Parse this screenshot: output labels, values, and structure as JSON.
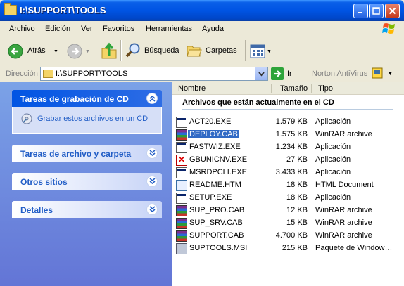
{
  "window": {
    "title": "I:\\SUPPORT\\TOOLS"
  },
  "menu": {
    "items": [
      "Archivo",
      "Edición",
      "Ver",
      "Favoritos",
      "Herramientas",
      "Ayuda"
    ]
  },
  "toolbar": {
    "back_label": "Atrás",
    "search_label": "Búsqueda",
    "folders_label": "Carpetas"
  },
  "address": {
    "label": "Dirección",
    "value": "I:\\SUPPORT\\TOOLS",
    "go_label": "Ir",
    "antivirus_label": "Norton AntiVirus"
  },
  "tasks": {
    "cd_title": "Tareas de grabación de CD",
    "cd_link": "Grabar estos archivos en un CD",
    "file_title": "Tareas de archivo y carpeta",
    "other_title": "Otros sitios",
    "details_title": "Detalles"
  },
  "columns": {
    "name": "Nombre",
    "size": "Tamaño",
    "type": "Tipo"
  },
  "group_title": "Archivos que están actualmente en el CD",
  "files": [
    {
      "name": "ACT20.EXE",
      "size": "1.579 KB",
      "type": "Aplicación",
      "icon": "exe-icon"
    },
    {
      "name": "DEPLOY.CAB",
      "size": "1.575 KB",
      "type": "WinRAR archive",
      "icon": "cab-icon",
      "selected": true
    },
    {
      "name": "FASTWIZ.EXE",
      "size": "1.234 KB",
      "type": "Aplicación",
      "icon": "exe-icon"
    },
    {
      "name": "GBUNICNV.EXE",
      "size": "27 KB",
      "type": "Aplicación",
      "icon": "gbunicnv-icon"
    },
    {
      "name": "MSRDPCLI.EXE",
      "size": "3.433 KB",
      "type": "Aplicación",
      "icon": "exe-icon"
    },
    {
      "name": "README.HTM",
      "size": "18 KB",
      "type": "HTML Document",
      "icon": "htm-icon"
    },
    {
      "name": "SETUP.EXE",
      "size": "18 KB",
      "type": "Aplicación",
      "icon": "exe-icon"
    },
    {
      "name": "SUP_PRO.CAB",
      "size": "12 KB",
      "type": "WinRAR archive",
      "icon": "cab-icon"
    },
    {
      "name": "SUP_SRV.CAB",
      "size": "15 KB",
      "type": "WinRAR archive",
      "icon": "cab-icon"
    },
    {
      "name": "SUPPORT.CAB",
      "size": "4.700 KB",
      "type": "WinRAR archive",
      "icon": "cab-icon"
    },
    {
      "name": "SUPTOOLS.MSI",
      "size": "215 KB",
      "type": "Paquete de Window…",
      "icon": "msi-icon"
    }
  ]
}
